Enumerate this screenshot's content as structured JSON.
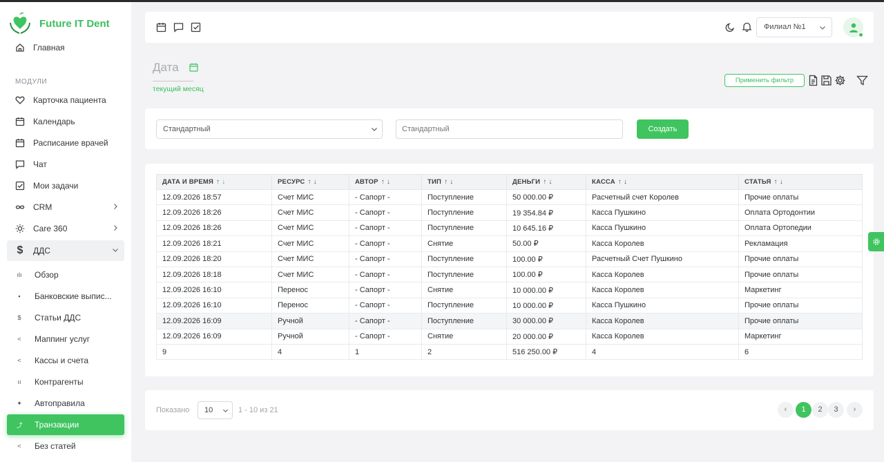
{
  "app": {
    "name": "Future IT Dent",
    "brand_color": "#3fc45f"
  },
  "sidebar": {
    "home": {
      "label": "Главная",
      "icon": "home-icon"
    },
    "section_label": "МОДУЛИ",
    "modules": [
      {
        "label": "Карточка пациента",
        "icon": "heart-icon"
      },
      {
        "label": "Календарь",
        "icon": "calendar-icon"
      },
      {
        "label": "Расписание врачей",
        "icon": "calendar-icon"
      },
      {
        "label": "Чат",
        "icon": "chat-icon"
      },
      {
        "label": "Мои задачи",
        "icon": "checkbox-icon"
      },
      {
        "label": "CRM",
        "icon": "infinity-icon"
      },
      {
        "label": "Care 360",
        "icon": "sun-icon"
      },
      {
        "label": "ДДС",
        "icon": "dollar-icon"
      }
    ],
    "dds_items": [
      {
        "label": "Обзор"
      },
      {
        "label": "Банковские выпис..."
      },
      {
        "label": "Статьи ДДС"
      },
      {
        "label": "Маппинг услуг"
      },
      {
        "label": "Кассы и счета"
      },
      {
        "label": "Контрагенты"
      },
      {
        "label": "Автоправила"
      },
      {
        "label": "Транзакции"
      },
      {
        "label": "Без статей"
      }
    ]
  },
  "header": {
    "branch": "Филиал №1"
  },
  "filter": {
    "date_title": "Дата",
    "date_sub": "текущий месяц",
    "apply_label": "Применить фильтр"
  },
  "controls": {
    "preset_select": "Стандартный",
    "preset_name_placeholder": "Стандартный",
    "create_label": "Создать"
  },
  "table": {
    "columns": [
      "ДАТА И ВРЕМЯ",
      "РЕСУРС",
      "АВТОР",
      "ТИП",
      "ДЕНЬГИ",
      "КАССА",
      "СТАТЬЯ"
    ],
    "rows": [
      [
        "12.09.2026 18:57",
        "Счет МИС",
        "- Сапорт -",
        "Поступление",
        "50 000.00 ₽",
        "Расчетный счет Королев",
        "Прочие оплаты"
      ],
      [
        "12.09.2026 18:26",
        "Счет МИС",
        "- Сапорт -",
        "Поступление",
        "19 354.84 ₽",
        "Касса Пушкино",
        "Оплата Ортодонтии"
      ],
      [
        "12.09.2026 18:26",
        "Счет МИС",
        "- Сапорт -",
        "Поступление",
        "10 645.16 ₽",
        "Касса Пушкино",
        "Оплата Ортопедии"
      ],
      [
        "12.09.2026 18:21",
        "Счет МИС",
        "- Сапорт -",
        "Снятие",
        "50.00 ₽",
        "Касса Королев",
        "Рекламация"
      ],
      [
        "12.09.2026 18:20",
        "Счет МИС",
        "- Сапорт -",
        "Поступление",
        "100.00 ₽",
        "Расчетный Счет Пушкино",
        "Прочие оплаты"
      ],
      [
        "12.09.2026 18:18",
        "Счет МИС",
        "- Сапорт -",
        "Поступление",
        "100.00 ₽",
        "Касса Королев",
        "Прочие оплаты"
      ],
      [
        "12.09.2026 16:10",
        "Перенос",
        "- Сапорт -",
        "Снятие",
        "10 000.00 ₽",
        "Касса Королев",
        "Маркетинг"
      ],
      [
        "12.09.2026 16:10",
        "Перенос",
        "- Сапорт -",
        "Поступление",
        "10 000.00 ₽",
        "Касса Пушкино",
        "Прочие оплаты"
      ],
      [
        "12.09.2026 16:09",
        "Ручной",
        "- Сапорт -",
        "Поступление",
        "30 000.00 ₽",
        "Касса Королев",
        "Прочие оплаты"
      ],
      [
        "12.09.2026 16:09",
        "Ручной",
        "- Сапорт -",
        "Снятие",
        "20 000.00 ₽",
        "Касса Королев",
        "Маркетинг"
      ]
    ],
    "totals": [
      "9",
      "4",
      "1",
      "2",
      "516 250.00 ₽",
      "4",
      "6"
    ]
  },
  "pagination": {
    "shown_label": "Показано",
    "per_page": "10",
    "range": "1 - 10 из 21",
    "pages": [
      "1",
      "2",
      "3"
    ],
    "current": "1"
  }
}
